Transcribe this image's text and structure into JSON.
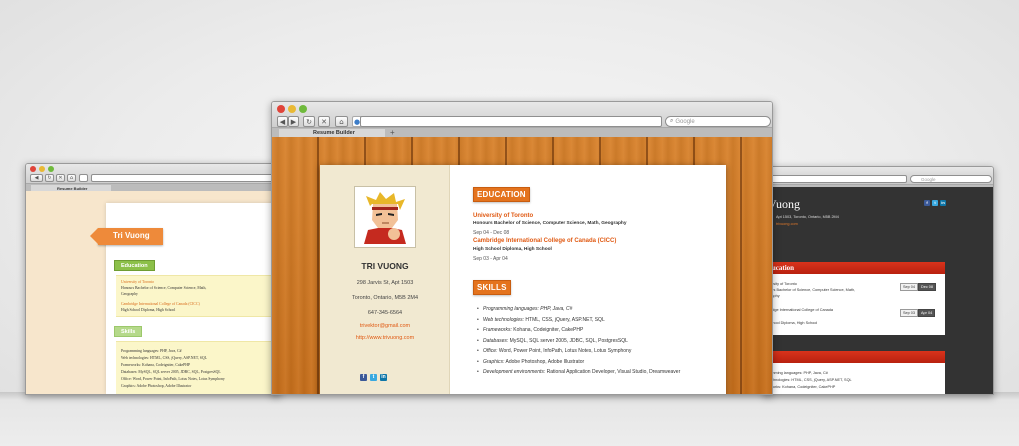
{
  "main_window": {
    "tab_title": "Resume Builder",
    "new_tab": "+",
    "search_placeholder": "Google",
    "nav": {
      "back": "◀",
      "forward": "▶",
      "reload": "↻",
      "stop": "✕",
      "home": "⌂"
    },
    "resume": {
      "name": "TRI VUONG",
      "address": "298 Jarvis St, Apt 1503",
      "city": "Toronto, Ontario, M5B 2M4",
      "phone": "647-345-6564",
      "email": "trivektor@gmail.com",
      "website": "http://www.trivuong.com",
      "social": {
        "facebook": "f",
        "twitter": "t",
        "linkedin": "in"
      },
      "education_label": "EDUCATION",
      "education": [
        {
          "school": "University of Toronto",
          "degree": "Honours Bachelor of Science, Computer Science, Math, Geography",
          "dates": "Sep 04 - Dec 08"
        },
        {
          "school": "Cambridge International College of Canada (CICC)",
          "degree": "High School Diploma, High School",
          "dates": "Sep 03 - Apr 04"
        }
      ],
      "skills_label": "SKILLS",
      "skills": [
        {
          "label": "Programming languages:",
          "value": " PHP, Java, C#",
          "italic_value": true
        },
        {
          "label": "Web technologies:",
          "value": " HTML, CSS, jQuery, ASP.NET, SQL",
          "italic_value": false
        },
        {
          "label": "Frameworks:",
          "value": " Kohana, Codeigniter, CakePHP",
          "italic_value": false
        },
        {
          "label": "Databases:",
          "value": " MySQL, SQL server 2005, JDBC, SQL, PostgresSQL",
          "italic_value": false
        },
        {
          "label": "Office:",
          "value": " Word, Power Point, InfoPath, Lotus Notes, Lotus Symphony",
          "italic_value": false
        },
        {
          "label": "Graphics:",
          "value": " Adobe Photoshop, Adobe Illustrator",
          "italic_value": false
        },
        {
          "label": "Development environments:",
          "value": " Rational Application Developer, Visual Studio, Dreamweaver",
          "italic_value": false
        }
      ]
    }
  },
  "left_window": {
    "tab_title": "Resume Builder",
    "name_tag": "Tri Vuong",
    "education_label": "Education",
    "edu_school_1": "University of Toronto",
    "edu_deg_1": "Honours Bachelor of Science, Computer Science, Math,",
    "edu_deg_1b": "Geography",
    "edu_school_2": "Cambridge International College of Canada (CICC)",
    "edu_deg_2": "High School Diploma, High School",
    "skills_label": "Skills",
    "skills": [
      "Programming languages: PHP, Java, C#",
      "Web technologies: HTML, CSS, jQuery, ASP.NET, SQL",
      "Frameworks: Kohana, Codeigniter, CakePHP",
      "Databases: MySQL, SQL server 2005, JDBC, SQL, PostgresSQL",
      "Office: Word, Power Point, InfoPath, Lotus Notes, Lotus Symphony",
      "Graphics: Adobe Photoshop, Adobe Illustrator"
    ]
  },
  "right_window": {
    "search_placeholder": "Google",
    "name": "Vuong",
    "address": "Apt 1503, Toronto, Ontario, M5B 2M4",
    "link": "trivuong.com",
    "education_label": "ducation",
    "edu_1_school": "versity of Toronto",
    "edu_1_degree": "ours Bachelor of Science, Computer Science, Math,",
    "edu_1_degree_b": "graphy",
    "edu_1_start": "Sep 04",
    "edu_1_end": "Dec 08",
    "edu_2_school": "bridge International College of Canada",
    "edu_2_school_b": "C)",
    "edu_2_degree": "School Diploma, High School",
    "edu_2_start": "Sep 03",
    "edu_2_end": "Apr 04",
    "skills_label": "s",
    "skills": [
      "ramming languages: PHP, Java, C#",
      "technologies: HTML, CSS, jQuery, ASP.NET, SQL",
      "eworks: Kohana, Codeigniter, CakePHP"
    ]
  },
  "colors": {
    "accent_orange": "#e4731d",
    "link_orange": "#e05a13",
    "wood": "#d07a24",
    "green_badge": "#8cc049",
    "red_header": "#c9281a"
  }
}
